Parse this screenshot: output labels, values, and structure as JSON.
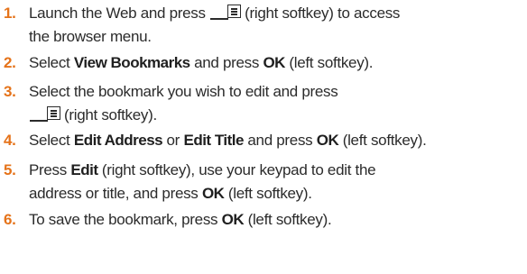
{
  "steps": [
    {
      "num": "1.",
      "line1_a": "Launch the Web and press",
      "line1_b": "(right softkey) to access",
      "line2": "the browser menu."
    },
    {
      "num": "2.",
      "a": "Select ",
      "b1": "View Bookmarks",
      "c": " and press ",
      "b2": "OK",
      "d": " (left softkey)."
    },
    {
      "num": "3.",
      "line1": "Select the bookmark you wish to edit and press",
      "line2": "(right softkey)."
    },
    {
      "num": "4.",
      "a": "Select ",
      "b1": "Edit Address",
      "c": " or ",
      "b2": "Edit Title",
      "d": " and press ",
      "b3": "OK",
      "e": " (left softkey)."
    },
    {
      "num": "5.",
      "a": "Press ",
      "b1": "Edit",
      "c": " (right softkey), use your keypad to edit the",
      "line2_a": "address or title, and press ",
      "line2_b": "OK",
      "line2_c": " (left softkey)."
    },
    {
      "num": "6.",
      "a": "To save the bookmark, press ",
      "b1": "OK",
      "c": " (left softkey)."
    }
  ],
  "icons": {
    "menu_softkey": "menu-softkey-icon"
  },
  "colors": {
    "step_number": "#e5731a",
    "text": "#2b2b2b"
  }
}
